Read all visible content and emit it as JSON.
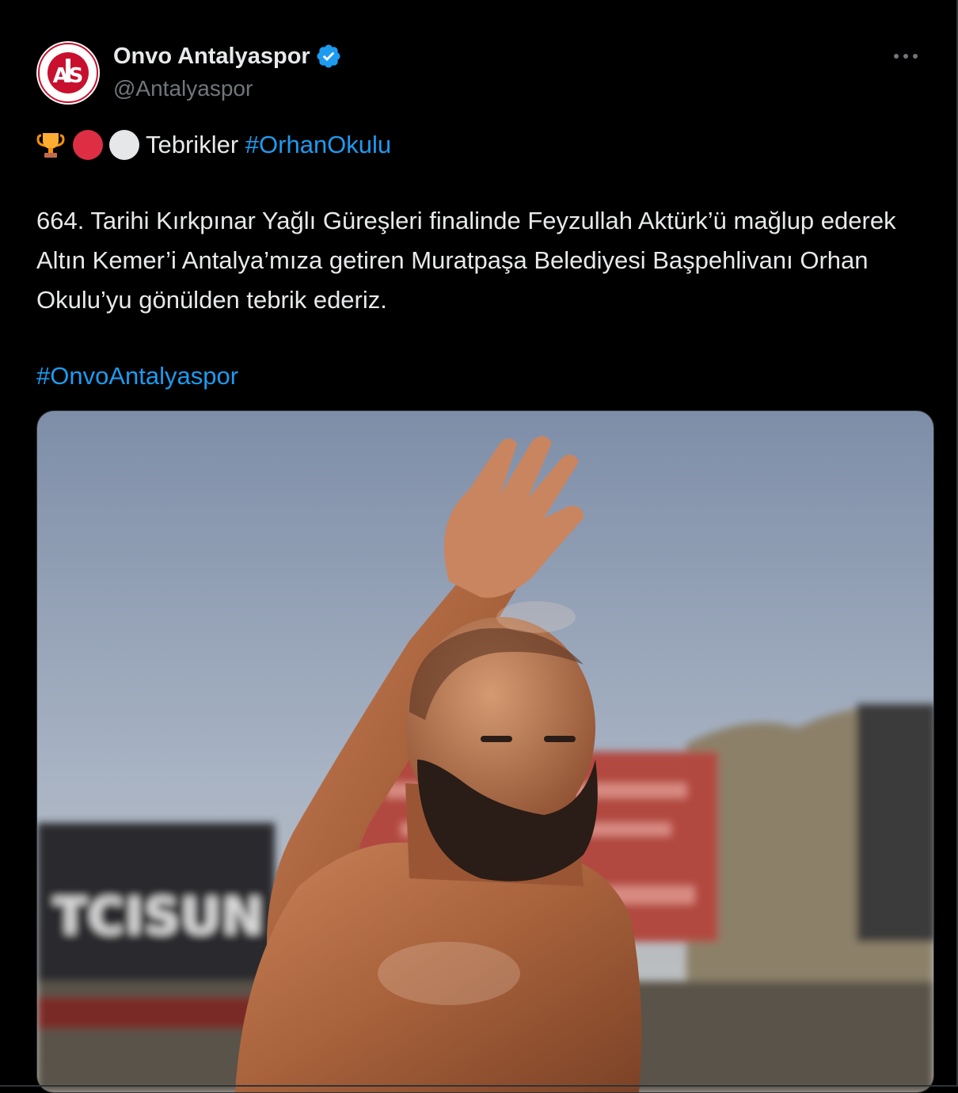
{
  "tweet": {
    "author": {
      "display_name": "Onvo Antalyaspor",
      "handle": "@Antalyaspor",
      "verified": true,
      "avatar_icon": "antalyaspor-logo",
      "avatar_logo_text": "ANTALYASPOR"
    },
    "more_icon": "more-horizontal-icon",
    "text": {
      "emojis": [
        "trophy-icon",
        "red-circle-icon",
        "white-circle-icon"
      ],
      "line1_word": "Tebrikler",
      "line1_hashtag": "#OrhanOkulu",
      "paragraph": "664. Tarihi Kırkpınar Yağlı Güreşleri finalinde Feyzullah Aktürk’ü mağlup ederek Altın Kemer’i Antalya’mıza getiren Muratpaşa Belediyesi Başpehlivanı Orhan Okulu’yu gönülden tebrik ederiz.",
      "hashtag": "#OnvoAntalyaspor"
    },
    "media": {
      "kind": "photo"
    }
  },
  "colors": {
    "background": "#000000",
    "text": "#e7e9ea",
    "secondary": "#71767b",
    "link": "#1d9bf0",
    "brand_red": "#c8102e"
  }
}
